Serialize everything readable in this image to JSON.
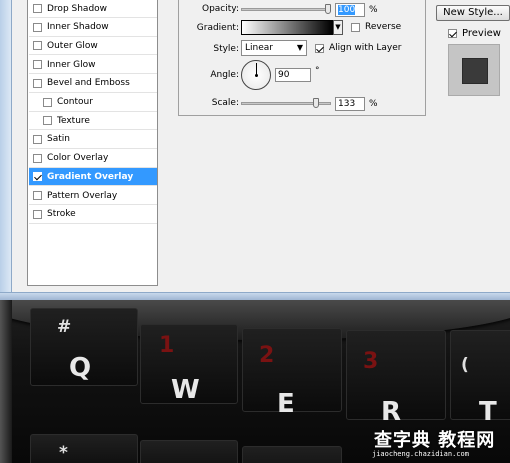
{
  "styles_list": {
    "items": [
      {
        "label": "Drop Shadow",
        "checked": false,
        "indent": false,
        "selected": false
      },
      {
        "label": "Inner Shadow",
        "checked": false,
        "indent": false,
        "selected": false
      },
      {
        "label": "Outer Glow",
        "checked": false,
        "indent": false,
        "selected": false
      },
      {
        "label": "Inner Glow",
        "checked": false,
        "indent": false,
        "selected": false
      },
      {
        "label": "Bevel and Emboss",
        "checked": false,
        "indent": false,
        "selected": false
      },
      {
        "label": "Contour",
        "checked": false,
        "indent": true,
        "selected": false
      },
      {
        "label": "Texture",
        "checked": false,
        "indent": true,
        "selected": false
      },
      {
        "label": "Satin",
        "checked": false,
        "indent": false,
        "selected": false
      },
      {
        "label": "Color Overlay",
        "checked": false,
        "indent": false,
        "selected": false
      },
      {
        "label": "Gradient Overlay",
        "checked": true,
        "indent": false,
        "selected": true
      },
      {
        "label": "Pattern Overlay",
        "checked": false,
        "indent": false,
        "selected": false
      },
      {
        "label": "Stroke",
        "checked": false,
        "indent": false,
        "selected": false
      }
    ]
  },
  "gradient_overlay": {
    "opacity_label": "Opacity:",
    "opacity_value": "100",
    "opacity_unit": "%",
    "opacity_level": 1.0,
    "gradient_label": "Gradient:",
    "gradient_from": "#ffffff",
    "gradient_to": "#000000",
    "reverse_label": "Reverse",
    "reverse_checked": false,
    "style_label": "Style:",
    "style_value": "Linear",
    "align_label": "Align with Layer",
    "align_checked": true,
    "angle_label": "Angle:",
    "angle_value": "90",
    "angle_unit": "°",
    "scale_label": "Scale:",
    "scale_value": "133",
    "scale_unit": "%"
  },
  "right_column": {
    "new_style_label": "New Style...",
    "preview_label": "Preview",
    "preview_checked": true
  },
  "keyboard": {
    "keys": [
      "#",
      "1",
      "2",
      "3",
      "(",
      "Q",
      "W",
      "E",
      "R",
      "T",
      "*"
    ]
  },
  "watermark": {
    "title": "查字典 教程网",
    "subtitle": "jiaocheng.chazidian.com"
  }
}
